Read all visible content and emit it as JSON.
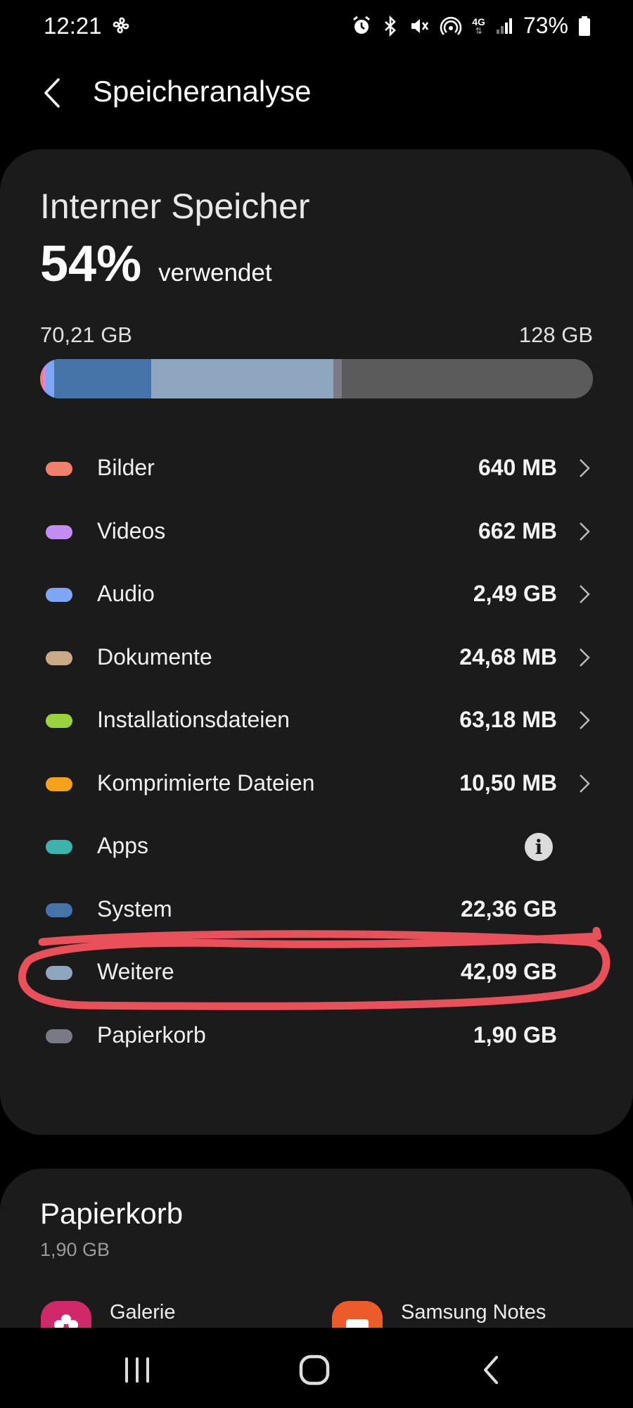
{
  "status_bar": {
    "time": "12:21",
    "battery": "73%",
    "network": "4G",
    "icons": [
      "fan-icon",
      "alarm-icon",
      "bluetooth-icon",
      "vibrate-icon",
      "hotspot-icon",
      "network-icon",
      "signal-icon",
      "battery-icon"
    ]
  },
  "header": {
    "title": "Speicheranalyse",
    "back_icon": "back-arrow-icon"
  },
  "storage": {
    "title": "Interner Speicher",
    "used_percent": "54%",
    "used_label": "verwendet",
    "used_amount": "70,21 GB",
    "total_amount": "128 GB",
    "used_fraction": 0.54,
    "bar_colors": {
      "bilder": "#f07f6b",
      "videos": "#c38cf0",
      "audio": "#7fa6f5",
      "system": "#4673a9",
      "weitere": "#8ea6c0",
      "papierkorb": "#7a7a86",
      "free": "#5b5b5b"
    }
  },
  "categories": [
    {
      "label": "Bilder",
      "value": "640 MB",
      "color": "#f07f6b",
      "has_chevron": true
    },
    {
      "label": "Videos",
      "value": "662 MB",
      "color": "#c38cf0",
      "has_chevron": true
    },
    {
      "label": "Audio",
      "value": "2,49 GB",
      "color": "#7fa6f5",
      "has_chevron": true
    },
    {
      "label": "Dokumente",
      "value": "24,68 MB",
      "color": "#c9aa84",
      "has_chevron": true
    },
    {
      "label": "Installationsdateien",
      "value": "63,18 MB",
      "color": "#9ad33b",
      "has_chevron": true
    },
    {
      "label": "Komprimierte Dateien",
      "value": "10,50 MB",
      "color": "#f5a21a",
      "has_chevron": true
    },
    {
      "label": "Apps",
      "value": "",
      "color": "#3db3ad",
      "has_info": true
    },
    {
      "label": "System",
      "value": "22,36 GB",
      "color": "#4673a9"
    },
    {
      "label": "Weitere",
      "value": "42,09 GB",
      "color": "#8ea6c0"
    },
    {
      "label": "Papierkorb",
      "value": "1,90 GB",
      "color": "#7a7a86"
    }
  ],
  "highlight_color": "#e8505a",
  "trash": {
    "title": "Papierkorb",
    "size": "1,90 GB",
    "apps": [
      {
        "label": "Galerie",
        "icon": "gallery-app-icon",
        "color": "#d1286a"
      },
      {
        "label": "Samsung Notes",
        "icon": "notes-app-icon",
        "color": "#ee5b2b"
      }
    ]
  },
  "nav": {
    "recents_icon": "recents-icon",
    "home_icon": "home-icon",
    "back_icon": "back-icon"
  }
}
